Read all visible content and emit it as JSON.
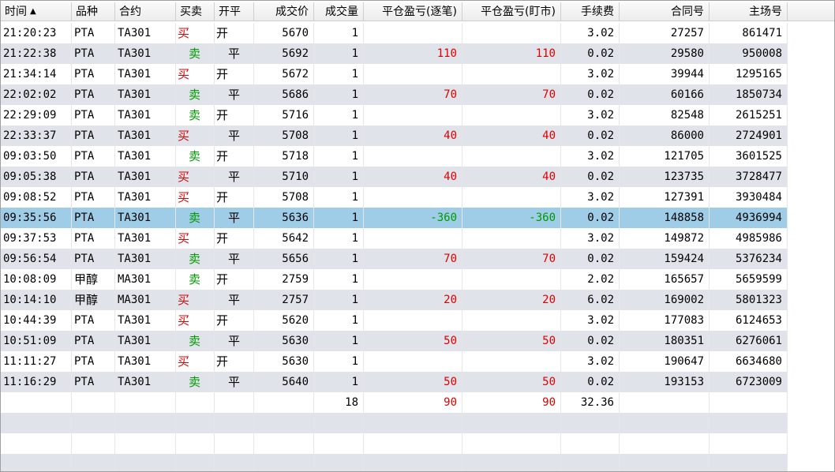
{
  "header": {
    "columns": [
      "时间",
      "品种",
      "合约",
      "买卖",
      "开平",
      "成交价",
      "成交量",
      "平仓盈亏(逐笔)",
      "平仓盈亏(盯市)",
      "手续费",
      "合同号",
      "主场号"
    ],
    "sort_indicator": "▲"
  },
  "colors": {
    "row_even": "#ffffff",
    "row_odd": "#e0e4ea",
    "row_selected": "#9fcde8",
    "buy": "#dd0000",
    "sell": "#009900",
    "profit": "#dd0000",
    "loss": "#009900"
  },
  "selected_index": 9,
  "rows": [
    {
      "time": "21:20:23",
      "product": "PTA",
      "contract": "TA301",
      "side": "买",
      "oc": "开",
      "price": "5670",
      "qty": "1",
      "pnl_trade": "",
      "pnl_mtm": "",
      "fee": "3.02",
      "order_no": "27257",
      "exch_no": "861471"
    },
    {
      "time": "21:22:38",
      "product": "PTA",
      "contract": "TA301",
      "side": "卖",
      "oc": "平",
      "price": "5692",
      "qty": "1",
      "pnl_trade": "110",
      "pnl_mtm": "110",
      "fee": "0.02",
      "order_no": "29580",
      "exch_no": "950008"
    },
    {
      "time": "21:34:14",
      "product": "PTA",
      "contract": "TA301",
      "side": "买",
      "oc": "开",
      "price": "5672",
      "qty": "1",
      "pnl_trade": "",
      "pnl_mtm": "",
      "fee": "3.02",
      "order_no": "39944",
      "exch_no": "1295165"
    },
    {
      "time": "22:02:02",
      "product": "PTA",
      "contract": "TA301",
      "side": "卖",
      "oc": "平",
      "price": "5686",
      "qty": "1",
      "pnl_trade": "70",
      "pnl_mtm": "70",
      "fee": "0.02",
      "order_no": "60166",
      "exch_no": "1850734"
    },
    {
      "time": "22:29:09",
      "product": "PTA",
      "contract": "TA301",
      "side": "卖",
      "oc": "开",
      "price": "5716",
      "qty": "1",
      "pnl_trade": "",
      "pnl_mtm": "",
      "fee": "3.02",
      "order_no": "82548",
      "exch_no": "2615251"
    },
    {
      "time": "22:33:37",
      "product": "PTA",
      "contract": "TA301",
      "side": "买",
      "oc": "平",
      "price": "5708",
      "qty": "1",
      "pnl_trade": "40",
      "pnl_mtm": "40",
      "fee": "0.02",
      "order_no": "86000",
      "exch_no": "2724901"
    },
    {
      "time": "09:03:50",
      "product": "PTA",
      "contract": "TA301",
      "side": "卖",
      "oc": "开",
      "price": "5718",
      "qty": "1",
      "pnl_trade": "",
      "pnl_mtm": "",
      "fee": "3.02",
      "order_no": "121705",
      "exch_no": "3601525"
    },
    {
      "time": "09:05:38",
      "product": "PTA",
      "contract": "TA301",
      "side": "买",
      "oc": "平",
      "price": "5710",
      "qty": "1",
      "pnl_trade": "40",
      "pnl_mtm": "40",
      "fee": "0.02",
      "order_no": "123735",
      "exch_no": "3728477"
    },
    {
      "time": "09:08:52",
      "product": "PTA",
      "contract": "TA301",
      "side": "买",
      "oc": "开",
      "price": "5708",
      "qty": "1",
      "pnl_trade": "",
      "pnl_mtm": "",
      "fee": "3.02",
      "order_no": "127391",
      "exch_no": "3930484"
    },
    {
      "time": "09:35:56",
      "product": "PTA",
      "contract": "TA301",
      "side": "卖",
      "oc": "平",
      "price": "5636",
      "qty": "1",
      "pnl_trade": "-360",
      "pnl_mtm": "-360",
      "fee": "0.02",
      "order_no": "148858",
      "exch_no": "4936994"
    },
    {
      "time": "09:37:53",
      "product": "PTA",
      "contract": "TA301",
      "side": "买",
      "oc": "开",
      "price": "5642",
      "qty": "1",
      "pnl_trade": "",
      "pnl_mtm": "",
      "fee": "3.02",
      "order_no": "149872",
      "exch_no": "4985986"
    },
    {
      "time": "09:56:54",
      "product": "PTA",
      "contract": "TA301",
      "side": "卖",
      "oc": "平",
      "price": "5656",
      "qty": "1",
      "pnl_trade": "70",
      "pnl_mtm": "70",
      "fee": "0.02",
      "order_no": "159424",
      "exch_no": "5376234"
    },
    {
      "time": "10:08:09",
      "product": "甲醇",
      "contract": "MA301",
      "side": "卖",
      "oc": "开",
      "price": "2759",
      "qty": "1",
      "pnl_trade": "",
      "pnl_mtm": "",
      "fee": "2.02",
      "order_no": "165657",
      "exch_no": "5659599"
    },
    {
      "time": "10:14:10",
      "product": "甲醇",
      "contract": "MA301",
      "side": "买",
      "oc": "平",
      "price": "2757",
      "qty": "1",
      "pnl_trade": "20",
      "pnl_mtm": "20",
      "fee": "6.02",
      "order_no": "169002",
      "exch_no": "5801323"
    },
    {
      "time": "10:44:39",
      "product": "PTA",
      "contract": "TA301",
      "side": "买",
      "oc": "开",
      "price": "5620",
      "qty": "1",
      "pnl_trade": "",
      "pnl_mtm": "",
      "fee": "3.02",
      "order_no": "177083",
      "exch_no": "6124653"
    },
    {
      "time": "10:51:09",
      "product": "PTA",
      "contract": "TA301",
      "side": "卖",
      "oc": "平",
      "price": "5630",
      "qty": "1",
      "pnl_trade": "50",
      "pnl_mtm": "50",
      "fee": "0.02",
      "order_no": "180351",
      "exch_no": "6276061"
    },
    {
      "time": "11:11:27",
      "product": "PTA",
      "contract": "TA301",
      "side": "买",
      "oc": "开",
      "price": "5630",
      "qty": "1",
      "pnl_trade": "",
      "pnl_mtm": "",
      "fee": "3.02",
      "order_no": "190647",
      "exch_no": "6634680"
    },
    {
      "time": "11:16:29",
      "product": "PTA",
      "contract": "TA301",
      "side": "卖",
      "oc": "平",
      "price": "5640",
      "qty": "1",
      "pnl_trade": "50",
      "pnl_mtm": "50",
      "fee": "0.02",
      "order_no": "193153",
      "exch_no": "6723009"
    }
  ],
  "totals": {
    "qty": "18",
    "pnl_trade": "90",
    "pnl_mtm": "90",
    "fee": "32.36"
  }
}
